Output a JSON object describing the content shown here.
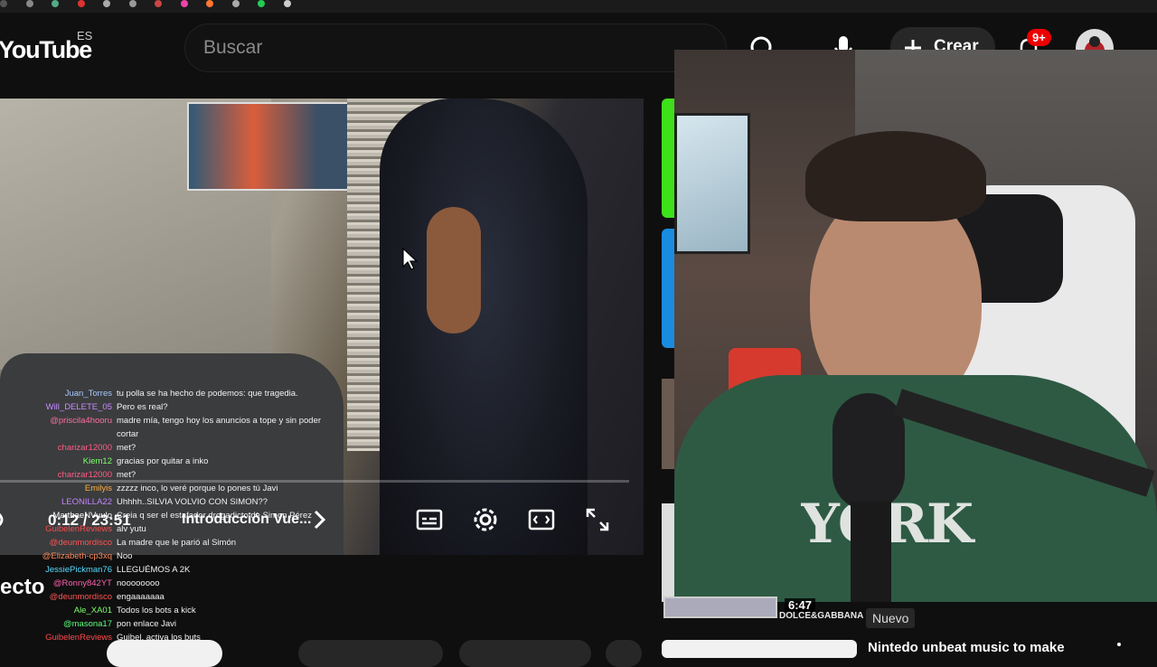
{
  "header": {
    "logo": "YouTube",
    "country": "ES",
    "search_placeholder": "Buscar",
    "create_label": "Crear",
    "notifications_badge": "9+"
  },
  "player": {
    "time": "0:12 / 23:51",
    "chapter": "Introducción Vue..."
  },
  "chat": [
    {
      "author": "Juan_Torres",
      "message": "tu polla se ha hecho de podemos: que tragedia.",
      "color": "#a6c8ff"
    },
    {
      "author": "Will_DELETE_05",
      "message": "Pero es real?",
      "color": "#c68cff"
    },
    {
      "author": "@priscila4hooru",
      "message": "madre mía, tengo hoy los anuncios a tope y sin poder",
      "color": "#ff6e9d"
    },
    {
      "author": "",
      "message": "cortar",
      "color": "#ffffff"
    },
    {
      "author": "charizar12000",
      "message": "met?",
      "color": "#ff5c84"
    },
    {
      "author": "Kiem12",
      "message": "gracias por quitar a inko",
      "color": "#7dff6a"
    },
    {
      "author": "charizar12000",
      "message": "met?",
      "color": "#ff5c84"
    },
    {
      "author": "Emilyis",
      "message": "zzzzz inco, lo veré porque lo pones tú Javi",
      "color": "#ffae44"
    },
    {
      "author": "LEONILLA22",
      "message": "Uhhhh..SILVIA VOLVIO CON SIMON??",
      "color": "#c285ff"
    },
    {
      "author": "MarthaeNVuulo",
      "message": "Creia q ser el estafador drogadicto de Simon Pérez",
      "color": "#ffffff"
    },
    {
      "author": "GuibelenReviews",
      "message": "alv yutu",
      "color": "#ff4a4a"
    },
    {
      "author": "@deunmordisco",
      "message": "La madre que le parió al Simón",
      "color": "#ff5252"
    },
    {
      "author": "@Elizabeth-cp3xq",
      "message": "Noo",
      "color": "#ff8a5c"
    },
    {
      "author": "JessiePickman76",
      "message": "LLEGUÉMOS A 2K",
      "color": "#55dcff"
    },
    {
      "author": "@Ronny842YT",
      "message": "noooooooo",
      "color": "#ff62b0"
    },
    {
      "author": "@deunmordisco",
      "message": "engaaaaaaa",
      "color": "#ff5252"
    },
    {
      "author": "Ale_XA01",
      "message": "Todos los bots a kick",
      "color": "#7dff6a"
    },
    {
      "author": "@masona17",
      "message": "pon enlace Javi",
      "color": "#5dff7e"
    },
    {
      "author": "GuibelenReviews",
      "message": "Guibel, activa los buts",
      "color": "#ff4a4a"
    }
  ],
  "below_video": {
    "title_fragment": "ecto"
  },
  "sidebar": {
    "duration": "6:47",
    "thumb_text": "DOLCE&GABBANA",
    "new_label": "Nuevo",
    "next_title": "Nintedo unbeat music to make"
  }
}
